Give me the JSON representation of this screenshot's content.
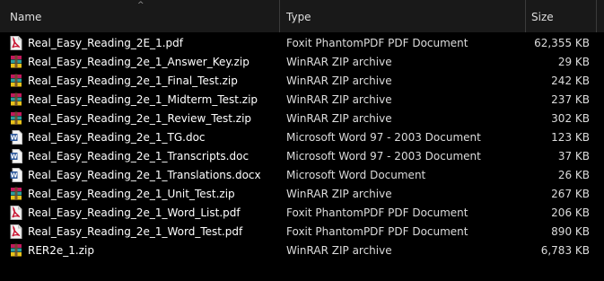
{
  "header": {
    "name_label": "Name",
    "type_label": "Type",
    "size_label": "Size",
    "sort_arrow": "^"
  },
  "colors": {
    "background": "#000000",
    "header_bg": "#191919",
    "text": "#ffffff",
    "secondary_text": "#dcdcdc",
    "pdf_icon": "#c8102e",
    "zip_icon_magenta": "#c2185b",
    "zip_icon_teal": "#2e9c9c",
    "zip_icon_yellow": "#e8c21a",
    "word_icon": "#2b579a"
  },
  "files": [
    {
      "name": "Real_Easy_Reading_2E_1.pdf",
      "type": "Foxit PhantomPDF PDF Document",
      "size": "62,355 KB",
      "icon": "pdf-icon"
    },
    {
      "name": "Real_Easy_Reading_2e_1_Answer_Key.zip",
      "type": "WinRAR ZIP archive",
      "size": "29 KB",
      "icon": "zip-icon"
    },
    {
      "name": "Real_Easy_Reading_2e_1_Final_Test.zip",
      "type": "WinRAR ZIP archive",
      "size": "242 KB",
      "icon": "zip-icon"
    },
    {
      "name": "Real_Easy_Reading_2e_1_Midterm_Test.zip",
      "type": "WinRAR ZIP archive",
      "size": "237 KB",
      "icon": "zip-icon"
    },
    {
      "name": "Real_Easy_Reading_2e_1_Review_Test.zip",
      "type": "WinRAR ZIP archive",
      "size": "302 KB",
      "icon": "zip-icon"
    },
    {
      "name": "Real_Easy_Reading_2e_1_TG.doc",
      "type": "Microsoft Word 97 - 2003 Document",
      "size": "123 KB",
      "icon": "word-icon"
    },
    {
      "name": "Real_Easy_Reading_2e_1_Transcripts.doc",
      "type": "Microsoft Word 97 - 2003 Document",
      "size": "37 KB",
      "icon": "word-icon"
    },
    {
      "name": "Real_Easy_Reading_2e_1_Translations.docx",
      "type": "Microsoft Word Document",
      "size": "26 KB",
      "icon": "word-icon"
    },
    {
      "name": "Real_Easy_Reading_2e_1_Unit_Test.zip",
      "type": "WinRAR ZIP archive",
      "size": "267 KB",
      "icon": "zip-icon"
    },
    {
      "name": "Real_Easy_Reading_2e_1_Word_List.pdf",
      "type": "Foxit PhantomPDF PDF Document",
      "size": "206 KB",
      "icon": "pdf-icon"
    },
    {
      "name": "Real_Easy_Reading_2e_1_Word_Test.pdf",
      "type": "Foxit PhantomPDF PDF Document",
      "size": "890 KB",
      "icon": "pdf-icon"
    },
    {
      "name": "RER2e_1.zip",
      "type": "WinRAR ZIP archive",
      "size": "6,783 KB",
      "icon": "zip-icon"
    }
  ]
}
